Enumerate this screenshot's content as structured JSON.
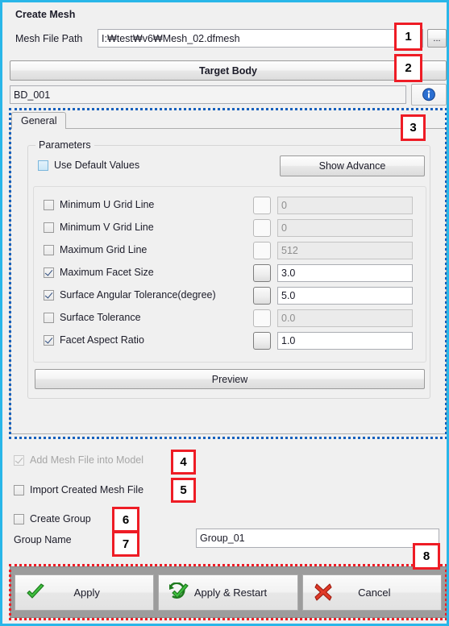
{
  "dialog": {
    "title": "Create Mesh"
  },
  "file": {
    "label": "Mesh File Path",
    "value": "I:₩test₩v6₩Mesh_02.dfmesh",
    "browse_label": "...",
    "browse_icon": "ellipsis-icon"
  },
  "target_body": {
    "button_label": "Target Body",
    "selected_value": "BD_001",
    "info_icon": "info-icon"
  },
  "tabs": [
    {
      "label": "General",
      "selected": true
    }
  ],
  "parameters": {
    "group_title": "Parameters",
    "use_default": {
      "label": "Use Default Values",
      "checked": false,
      "highlight": true
    },
    "show_advance_label": "Show Advance",
    "rows": [
      {
        "label": "Minimum U Grid Line",
        "checked": false,
        "value": "0",
        "enabled": false
      },
      {
        "label": "Minimum V Grid Line",
        "checked": false,
        "value": "0",
        "enabled": false
      },
      {
        "label": "Maximum Grid Line",
        "checked": false,
        "value": "512",
        "enabled": false
      },
      {
        "label": "Maximum Facet Size",
        "checked": true,
        "value": "3.0",
        "enabled": true
      },
      {
        "label": "Surface Angular Tolerance(degree)",
        "checked": true,
        "value": "5.0",
        "enabled": true
      },
      {
        "label": "Surface Tolerance",
        "checked": false,
        "value": "0.0",
        "enabled": false
      },
      {
        "label": "Facet Aspect Ratio",
        "checked": true,
        "value": "1.0",
        "enabled": true
      }
    ],
    "preview_label": "Preview"
  },
  "options": {
    "add_mesh": {
      "label": "Add Mesh File into Model",
      "checked": true,
      "disabled": true
    },
    "import_mesh": {
      "label": "Import Created Mesh File",
      "checked": false,
      "disabled": false
    },
    "create_group": {
      "label": "Create Group",
      "checked": false,
      "disabled": false
    },
    "group_name_label": "Group Name",
    "group_name_value": "Group_01"
  },
  "actions": {
    "apply": {
      "label": "Apply",
      "icon": "green-check-icon"
    },
    "apply_restart": {
      "label": "Apply & Restart",
      "icon": "green-check-refresh-icon"
    },
    "cancel": {
      "label": "Cancel",
      "icon": "red-x-icon"
    }
  },
  "annotations": {
    "badges": [
      {
        "n": "1"
      },
      {
        "n": "2"
      },
      {
        "n": "3"
      },
      {
        "n": "4"
      },
      {
        "n": "5"
      },
      {
        "n": "6"
      },
      {
        "n": "7"
      },
      {
        "n": "8"
      }
    ]
  },
  "colors": {
    "window_border": "#29b6e8",
    "annotation_red": "#ee1c25",
    "annotation_blue": "#1560bd",
    "face_gray": "#f0f0f0"
  }
}
